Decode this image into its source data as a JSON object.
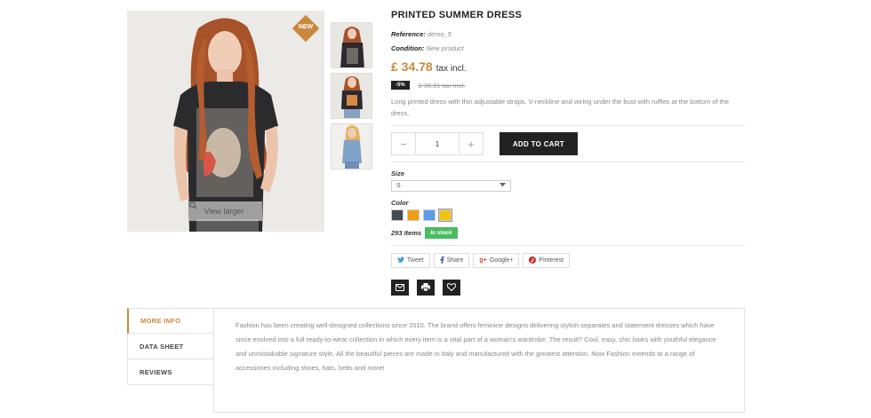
{
  "product": {
    "badge": "NEW",
    "view_larger": "View larger",
    "title": "PRINTED SUMMER DRESS",
    "reference_label": "Reference:",
    "reference_value": "demo_5",
    "condition_label": "Condition:",
    "condition_value": "New product",
    "price": "£ 34.78",
    "tax": "tax incl.",
    "discount": "-5%",
    "old_price": "£ 36.61 tax incl.",
    "description": "Long printed dress with thin adjustable straps. V-neckline and wiring under the bust with ruffles at the bottom of the dress."
  },
  "cart": {
    "minus": "−",
    "quantity": "1",
    "plus": "+",
    "add_to_cart": "ADD TO CART"
  },
  "options": {
    "size_label": "Size",
    "size_value": "S",
    "color_label": "Color",
    "colors": [
      "#434a54",
      "#f39c11",
      "#5d9cec",
      "#f1c40f"
    ],
    "stock_count": "293 Items",
    "stock_status": "In stock"
  },
  "share": {
    "tweet": "Tweet",
    "share": "Share",
    "google": "Google+",
    "pinterest": "Pinterest"
  },
  "tabs": {
    "items": [
      "MORE INFO",
      "DATA SHEET",
      "REVIEWS"
    ],
    "content": "Fashion has been creating well-designed collections since 2010. The brand offers feminine designs delivering stylish separates and statement dresses which have since evolved into a full ready-to-wear collection in which every item is a vital part of a woman's wardrobe. The result? Cool, easy, chic looks with youthful elegance and unmistakable signature style. All the beautiful pieces are made in Italy and manufactured with the greatest attention. Now Fashion extends to a range of accessories including shoes, hats, belts and more!"
  }
}
